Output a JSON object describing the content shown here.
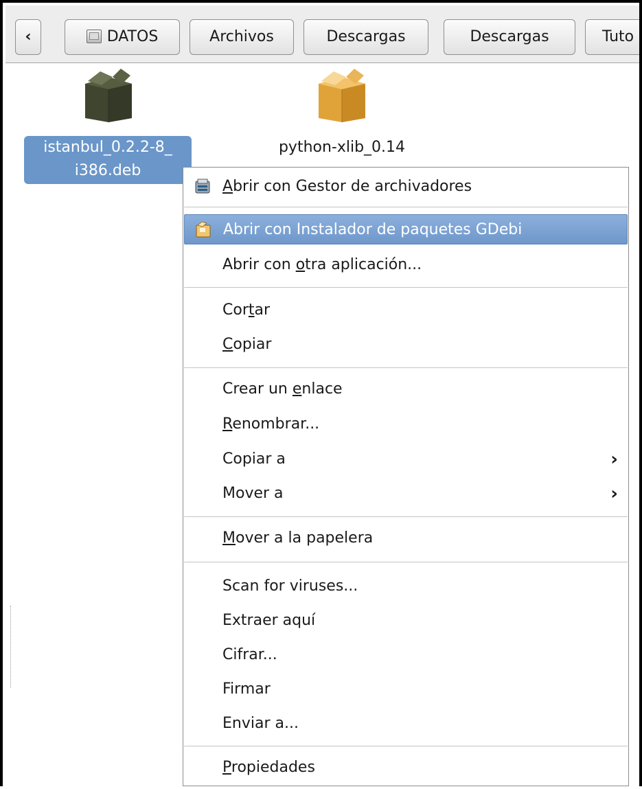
{
  "pathbar": {
    "back_symbol": "‹",
    "buttons": [
      "DATOS",
      "Archivos",
      "Descargas",
      "Descargas",
      "Tuto"
    ]
  },
  "files": [
    {
      "name_line1": "istanbul_0.2.2-8_",
      "name_line2": "i386.deb",
      "icon": "package-dark-icon",
      "selected": true
    },
    {
      "name_line1": "python-xlib_0.14",
      "name_line2": "",
      "icon": "package-orange-icon",
      "selected": false
    }
  ],
  "context_menu": {
    "items": [
      {
        "label_pre": "",
        "mnemonic": "A",
        "label_post": "brir con Gestor de archivadores",
        "icon": "archive-manager-icon"
      },
      {
        "label_pre": "Abrir con Instalador de paquetes GDebi",
        "mnemonic": "",
        "label_post": "",
        "icon": "gdebi-package-icon",
        "highlighted": true
      },
      {
        "label_pre": "Abrir con ",
        "mnemonic": "o",
        "label_post": "tra aplicación..."
      },
      {
        "label_pre": "Cor",
        "mnemonic": "t",
        "label_post": "ar"
      },
      {
        "label_pre": "",
        "mnemonic": "C",
        "label_post": "opiar"
      },
      {
        "label_pre": "Crear un ",
        "mnemonic": "e",
        "label_post": "nlace"
      },
      {
        "label_pre": "",
        "mnemonic": "R",
        "label_post": "enombrar..."
      },
      {
        "label_pre": "Copiar a",
        "mnemonic": "",
        "label_post": "",
        "submenu": true
      },
      {
        "label_pre": "Mover a",
        "mnemonic": "",
        "label_post": "",
        "submenu": true
      },
      {
        "label_pre": "",
        "mnemonic": "M",
        "label_post": "over a la papelera"
      },
      {
        "label_pre": "Scan for viruses...",
        "mnemonic": "",
        "label_post": ""
      },
      {
        "label_pre": "Extraer aquí",
        "mnemonic": "",
        "label_post": ""
      },
      {
        "label_pre": "Cifrar...",
        "mnemonic": "",
        "label_post": ""
      },
      {
        "label_pre": "Firmar",
        "mnemonic": "",
        "label_post": ""
      },
      {
        "label_pre": "Enviar a...",
        "mnemonic": "",
        "label_post": ""
      },
      {
        "label_pre": "",
        "mnemonic": "P",
        "label_post": "ropiedades"
      }
    ],
    "submenu_symbol": "›"
  },
  "colors": {
    "selection": "#6a96c9",
    "menu_highlight": "#7aa0d2"
  }
}
